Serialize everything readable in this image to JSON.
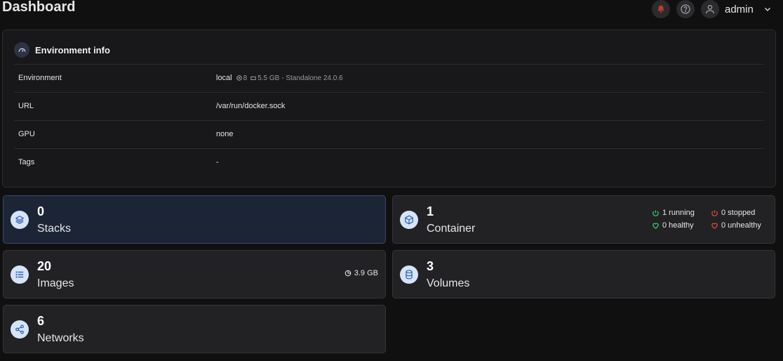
{
  "header": {
    "title": "Dashboard",
    "notification_icon": "bell-icon",
    "help_icon": "help-circle-icon",
    "user_icon": "user-icon",
    "username": "admin"
  },
  "environment": {
    "title": "Environment info",
    "rows": [
      {
        "key": "Environment",
        "value": "local"
      },
      {
        "key": "URL",
        "value": "/var/run/docker.sock"
      },
      {
        "key": "GPU",
        "value": "none"
      },
      {
        "key": "Tags",
        "value": "-"
      }
    ],
    "cpu": "8",
    "memory": "5.5 GB",
    "details": "- Standalone 24.0.6"
  },
  "tiles": {
    "stacks": {
      "count": "0",
      "label": "Stacks",
      "icon": "layers-icon"
    },
    "container": {
      "count": "1",
      "label": "Container",
      "icon": "box-icon",
      "running": "1 running",
      "stopped": "0 stopped",
      "healthy": "0 healthy",
      "unhealthy": "0 unhealthy"
    },
    "images": {
      "count": "20",
      "label": "Images",
      "icon": "list-icon",
      "size": "3.9 GB"
    },
    "volumes": {
      "count": "3",
      "label": "Volumes",
      "icon": "database-icon"
    },
    "networks": {
      "count": "6",
      "label": "Networks",
      "icon": "share-icon"
    }
  },
  "colors": {
    "accent_icon_bg": "#d6e4f7",
    "accent_icon_fg": "#2f64b6",
    "running": "#3ecf6a",
    "stopped": "#e0503a",
    "healthy": "#3ecf6a",
    "unhealthy": "#e0503a",
    "active_tile": "#1c2535"
  }
}
